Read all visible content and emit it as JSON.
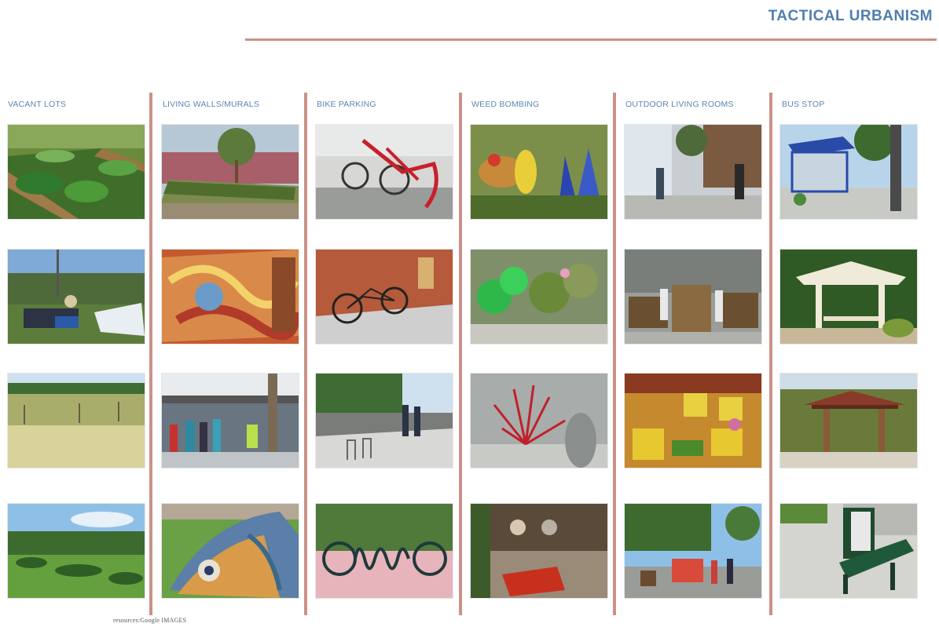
{
  "header": {
    "title": "TACTICAL URBANISM"
  },
  "columns": [
    {
      "label": "VACANT LOTS"
    },
    {
      "label": "LIVING WALLS/MURALS"
    },
    {
      "label": "BIKE PARKING"
    },
    {
      "label": "WEED BOMBING"
    },
    {
      "label": "OUTDOOR LIVING ROOMS"
    },
    {
      "label": "BUS STOP"
    }
  ],
  "footer": {
    "credit": "resources:Google IMAGES"
  },
  "colors": {
    "title": "#4f7fae",
    "heading": "#5b86b3",
    "rule": "#c98f86"
  }
}
